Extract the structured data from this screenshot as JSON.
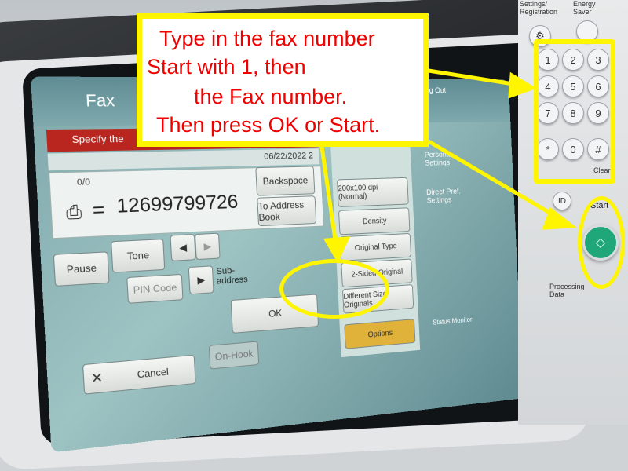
{
  "callout": {
    "line1": "Type in the fax number",
    "line2": "Start with 1, then",
    "line3": "the Fax number.",
    "line4": "Then press OK or Start."
  },
  "panel": {
    "settings_label": "Settings/ Registration",
    "energy_label": "Energy Saver",
    "start_label": "Start",
    "processing_label": "Processing Data",
    "id_label": "ID",
    "clear_label": "Clear",
    "keys": [
      "1",
      "2",
      "3",
      "4",
      "5",
      "6",
      "7",
      "8",
      "9",
      "*",
      "0",
      "#"
    ]
  },
  "screen": {
    "header_title": "Fax",
    "status_text": "Specify the",
    "date": "06/22/2022 2",
    "counter": "0/0",
    "fax_number": "12699799726",
    "backspace_label": "Backspace",
    "address_book_label": "To Address Book",
    "tone_label": "Tone",
    "pause_label": "Pause",
    "pin_code_label": "PIN Code",
    "subaddress_label": "Sub-address",
    "ok_label": "OK",
    "cancel_label": "Cancel",
    "on_hook_label": "On-Hook",
    "log_out_label": "Log Out",
    "personal_settings_label": "Personal Settings",
    "direct_send_label": "Direct Pref. Settings",
    "resolution_label": "200x100 dpi (Normal)",
    "density_label": "Density",
    "original_type_label": "Original Type",
    "two_sided_label": "2-Sided Original",
    "different_size_label": "Different Size Originals",
    "options_label": "Options",
    "status_monitor_label": "Status Monitor"
  },
  "colors": {
    "highlight": "#fff500",
    "callout_text": "#f20000",
    "start_button": "#1fa77a"
  }
}
